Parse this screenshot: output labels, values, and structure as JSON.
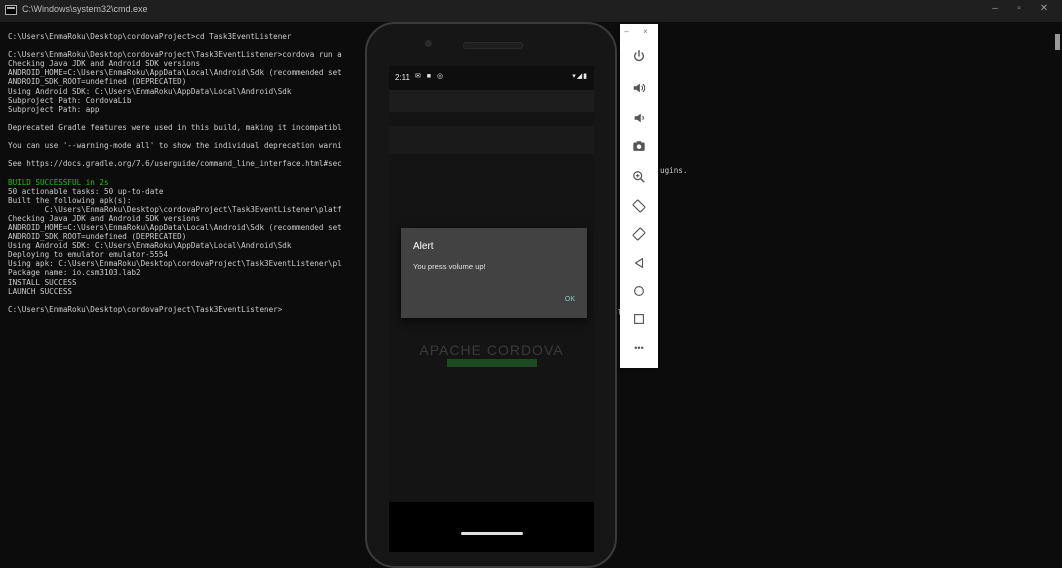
{
  "window": {
    "title": "C:\\Windows\\system32\\cmd.exe",
    "controls": [
      "–",
      "▫",
      "✕"
    ]
  },
  "console": {
    "lines": [
      {
        "text": "C:\\Users\\EnmaRoku\\Desktop\\cordovaProject>cd Task3EventListener",
        "color": "#cccccc"
      },
      {
        "text": "",
        "color": "#cccccc"
      },
      {
        "text": "C:\\Users\\EnmaRoku\\Desktop\\cordovaProject\\Task3EventListener>cordova run a",
        "color": "#cccccc"
      },
      {
        "text": "Checking Java JDK and Android SDK versions",
        "color": "#cccccc"
      },
      {
        "text": "ANDROID_HOME=C:\\Users\\EnmaRoku\\AppData\\Local\\Android\\Sdk (recommended set",
        "color": "#cccccc"
      },
      {
        "text": "ANDROID_SDK_ROOT=undefined (DEPRECATED)",
        "color": "#cccccc"
      },
      {
        "text": "Using Android SDK: C:\\Users\\EnmaRoku\\AppData\\Local\\Android\\Sdk",
        "color": "#cccccc"
      },
      {
        "text": "Subproject Path: CordovaLib",
        "color": "#cccccc"
      },
      {
        "text": "Subproject Path: app",
        "color": "#cccccc"
      },
      {
        "text": "",
        "color": "#cccccc"
      },
      {
        "text": "Deprecated Gradle features were used in this build, making it incompatibl",
        "color": "#cccccc"
      },
      {
        "text": "",
        "color": "#cccccc"
      },
      {
        "text": "You can use '--warning-mode all' to show the individual deprecation warni",
        "color": "#cccccc"
      },
      {
        "text": "",
        "color": "#cccccc"
      },
      {
        "text": "See https://docs.gradle.org/7.6/userguide/command_line_interface.html#sec",
        "color": "#cccccc"
      },
      {
        "text": "",
        "color": "#cccccc"
      },
      {
        "text": "BUILD SUCCESSFUL in 2s",
        "color": "#16c60c"
      },
      {
        "text": "50 actionable tasks: 50 up-to-date",
        "color": "#cccccc"
      },
      {
        "text": "Built the following apk(s):",
        "color": "#cccccc"
      },
      {
        "text": "        C:\\Users\\EnmaRoku\\Desktop\\cordovaProject\\Task3EventListener\\platf",
        "color": "#cccccc"
      },
      {
        "text": "Checking Java JDK and Android SDK versions",
        "color": "#cccccc"
      },
      {
        "text": "ANDROID_HOME=C:\\Users\\EnmaRoku\\AppData\\Local\\Android\\Sdk (recommended set",
        "color": "#cccccc"
      },
      {
        "text": "ANDROID_SDK_ROOT=undefined (DEPRECATED)",
        "color": "#cccccc"
      },
      {
        "text": "Using Android SDK: C:\\Users\\EnmaRoku\\AppData\\Local\\Android\\Sdk",
        "color": "#cccccc"
      },
      {
        "text": "Deploying to emulator emulator-5554",
        "color": "#cccccc"
      },
      {
        "text": "Using apk: C:\\Users\\EnmaRoku\\Desktop\\cordovaProject\\Task3EventListener\\pl",
        "color": "#cccccc"
      },
      {
        "text": "Package name: io.csm3103.lab2",
        "color": "#cccccc"
      },
      {
        "text": "INSTALL SUCCESS",
        "color": "#cccccc"
      },
      {
        "text": "LAUNCH SUCCESS",
        "color": "#cccccc"
      },
      {
        "text": "",
        "color": "#cccccc"
      },
      {
        "text": "C:\\Users\\EnmaRoku\\Desktop\\cordovaProject\\Task3EventListener>",
        "color": "#cccccc"
      }
    ],
    "overflow_fragments": [
      {
        "text": "ugins.",
        "row": 14
      },
      {
        "text": "pl",
        "row": 25
      }
    ]
  },
  "phone": {
    "status": {
      "time": "2:11",
      "left_icons": "✉ ■ ◎",
      "right_icons": "▾◢▮"
    },
    "background_title": "APACHE CORDOVA",
    "dialog": {
      "title": "Alert",
      "message": "You press volume up!",
      "ok_label": "OK"
    }
  },
  "emulator": {
    "top_controls": "– ×",
    "more_label": "•••"
  }
}
